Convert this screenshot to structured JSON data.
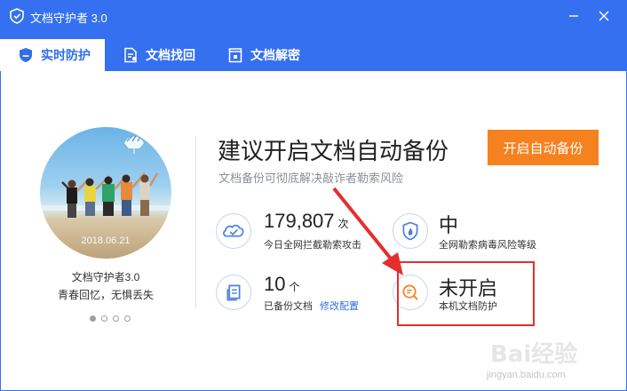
{
  "window": {
    "title": "文档守护者 3.0",
    "minimize_symbol": "–",
    "close_symbol": "✕"
  },
  "tabs": [
    {
      "label": "实时防护",
      "icon": "shield-icon",
      "active": true
    },
    {
      "label": "文档找回",
      "icon": "document-restore-icon",
      "active": false
    },
    {
      "label": "文档解密",
      "icon": "document-lock-icon",
      "active": false
    }
  ],
  "promo": {
    "photo_date": "2018.06.21",
    "product_name": "文档守护者3.0",
    "slogan": "青春回忆，无惧丢失",
    "carousel_count": 4,
    "carousel_active_index": 0
  },
  "main": {
    "headline": "建议开启文档自动备份",
    "subline": "文档备份可彻底解决敲诈者勒索风险",
    "cta_label": "开启自动备份"
  },
  "stats": {
    "intercepts": {
      "value": "179,807",
      "unit": "次",
      "label": "今日全网拦截勒索攻击",
      "icon": "cloud-check-icon"
    },
    "risk": {
      "value": "中",
      "label": "全网勒索病毒风险等级",
      "icon": "shield-flame-icon"
    },
    "backups": {
      "value": "10",
      "unit": "个",
      "label": "已备份文档",
      "link": "修改配置",
      "icon": "document-copy-icon"
    },
    "protection": {
      "value": "未开启",
      "label": "本机文档防护",
      "icon": "document-search-icon"
    }
  },
  "watermark": {
    "text_big": "Bai经验",
    "text_small": "jingyan.baidu.com"
  },
  "colors": {
    "brand_blue": "#3570f0",
    "accent_orange": "#f5811f",
    "highlight_red": "#e62e2e",
    "link_blue": "#2f6fe8"
  }
}
